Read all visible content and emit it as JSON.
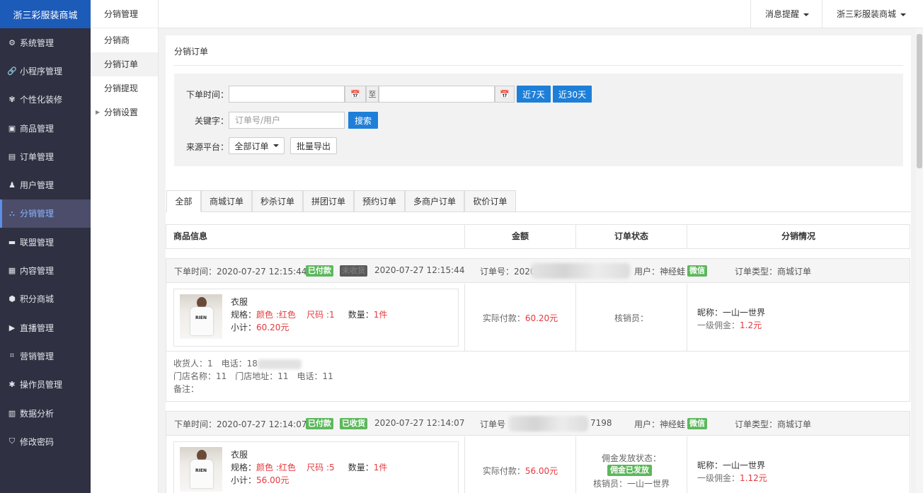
{
  "brand": "浙三彩服装商城",
  "nav": [
    {
      "icon": "gear-icon",
      "glyph": "⚙",
      "label": "系统管理"
    },
    {
      "icon": "link-icon",
      "glyph": "🔗",
      "label": "小程序管理"
    },
    {
      "icon": "palette-icon",
      "glyph": "✾",
      "label": "个性化装修"
    },
    {
      "icon": "briefcase-icon",
      "glyph": "▣",
      "label": "商品管理"
    },
    {
      "icon": "calendar-icon",
      "glyph": "▤",
      "label": "订单管理"
    },
    {
      "icon": "user-icon",
      "glyph": "♟",
      "label": "用户管理"
    },
    {
      "icon": "sitemap-icon",
      "glyph": "⛬",
      "label": "分销管理"
    },
    {
      "icon": "card-icon",
      "glyph": "▬",
      "label": "联盟管理"
    },
    {
      "icon": "content-icon",
      "glyph": "▦",
      "label": "内容管理"
    },
    {
      "icon": "cube-icon",
      "glyph": "⬢",
      "label": "积分商城"
    },
    {
      "icon": "play-icon",
      "glyph": "▶",
      "label": "直播管理"
    },
    {
      "icon": "marketing-icon",
      "glyph": "⌗",
      "label": "营销管理"
    },
    {
      "icon": "cog-icon",
      "glyph": "✱",
      "label": "操作员管理"
    },
    {
      "icon": "bar-chart-icon",
      "glyph": "▥",
      "label": "数据分析"
    },
    {
      "icon": "shield-icon",
      "glyph": "⛉",
      "label": "修改密码"
    }
  ],
  "active_nav_index": 6,
  "subnav": {
    "title": "分销管理",
    "items": [
      "分销商",
      "分销订单",
      "分销提现",
      "分销设置"
    ]
  },
  "topbar": {
    "messages": "消息提醒",
    "shop": "浙三彩服装商城"
  },
  "page": {
    "title": "分销订单"
  },
  "filter": {
    "order_time_label": "下单时间：",
    "date_start": "",
    "date_end": "",
    "to": "至",
    "last7": "近7天",
    "last30": "近30天",
    "keyword_label": "关键字：",
    "keyword_placeholder": "订单号/用户",
    "search": "搜索",
    "source_label": "来源平台：",
    "source_value": "全部订单",
    "export": "批量导出"
  },
  "tabs": [
    "全部",
    "商城订单",
    "秒杀订单",
    "拼团订单",
    "预约订单",
    "多商户订单",
    "砍价订单"
  ],
  "table_header": {
    "goods": "商品信息",
    "amount": "金额",
    "status": "订单状态",
    "distribution": "分销情况"
  },
  "orders": [
    {
      "order_time_label": "下单时间：",
      "order_time": "2020-07-27 12:15:44",
      "badge1": "已付款",
      "badge2": "未收货",
      "time2": "2020-07-27 12:15:44",
      "order_no_label": "订单号：2020",
      "order_no_suffix": "",
      "user_label": "用户：神经蛙",
      "platform": "微信",
      "type_label": "订单类型：商城订单",
      "goods_name": "衣服",
      "spec_label": "规格：",
      "color": "颜色 :红色",
      "size": "尺码 :1",
      "qty_label": "数量：",
      "qty": "1件",
      "subtotal_label": "小计：",
      "subtotal": "60.20元",
      "paid_label": "实际付款：",
      "paid": "60.20元",
      "commission_status_label": "",
      "commission_status": "",
      "verifier": "核销员：",
      "nickname": "昵称：一山一世界",
      "level1_label": "一级佣金：",
      "level1": "1.2元",
      "receiver": "收货人：1　电话：18",
      "store": "门店名称：11　门店地址：11　电话：11",
      "remark": "备注："
    },
    {
      "order_time_label": "下单时间：",
      "order_time": "2020-07-27 12:14:07",
      "badge1": "已付款",
      "badge2": "已收货",
      "time2": "2020-07-27 12:14:07",
      "order_no_label": "订单号",
      "order_no_suffix": "7198",
      "user_label": "用户：神经蛙",
      "platform": "微信",
      "type_label": "订单类型：商城订单",
      "goods_name": "衣服",
      "spec_label": "规格：",
      "color": "颜色 :红色",
      "size": "尺码 :5",
      "qty_label": "数量：",
      "qty": "1件",
      "subtotal_label": "小计：",
      "subtotal": "56.00元",
      "paid_label": "实际付款：",
      "paid": "56.00元",
      "commission_status_label": "佣金发放状态：",
      "commission_status": "佣金已发放",
      "verifier": "核销员：一山一世界",
      "nickname": "昵称：一山一世界",
      "level1_label": "一级佣金：",
      "level1": "1.12元",
      "receiver": "",
      "store": "",
      "remark": ""
    }
  ],
  "colors": {
    "sidebar_bg": "#2f3042",
    "brand_bg": "#1d5bb8",
    "accent_blue": "#1e7fd8",
    "badge_green": "#5cb85c",
    "price_red": "#e4393c"
  }
}
